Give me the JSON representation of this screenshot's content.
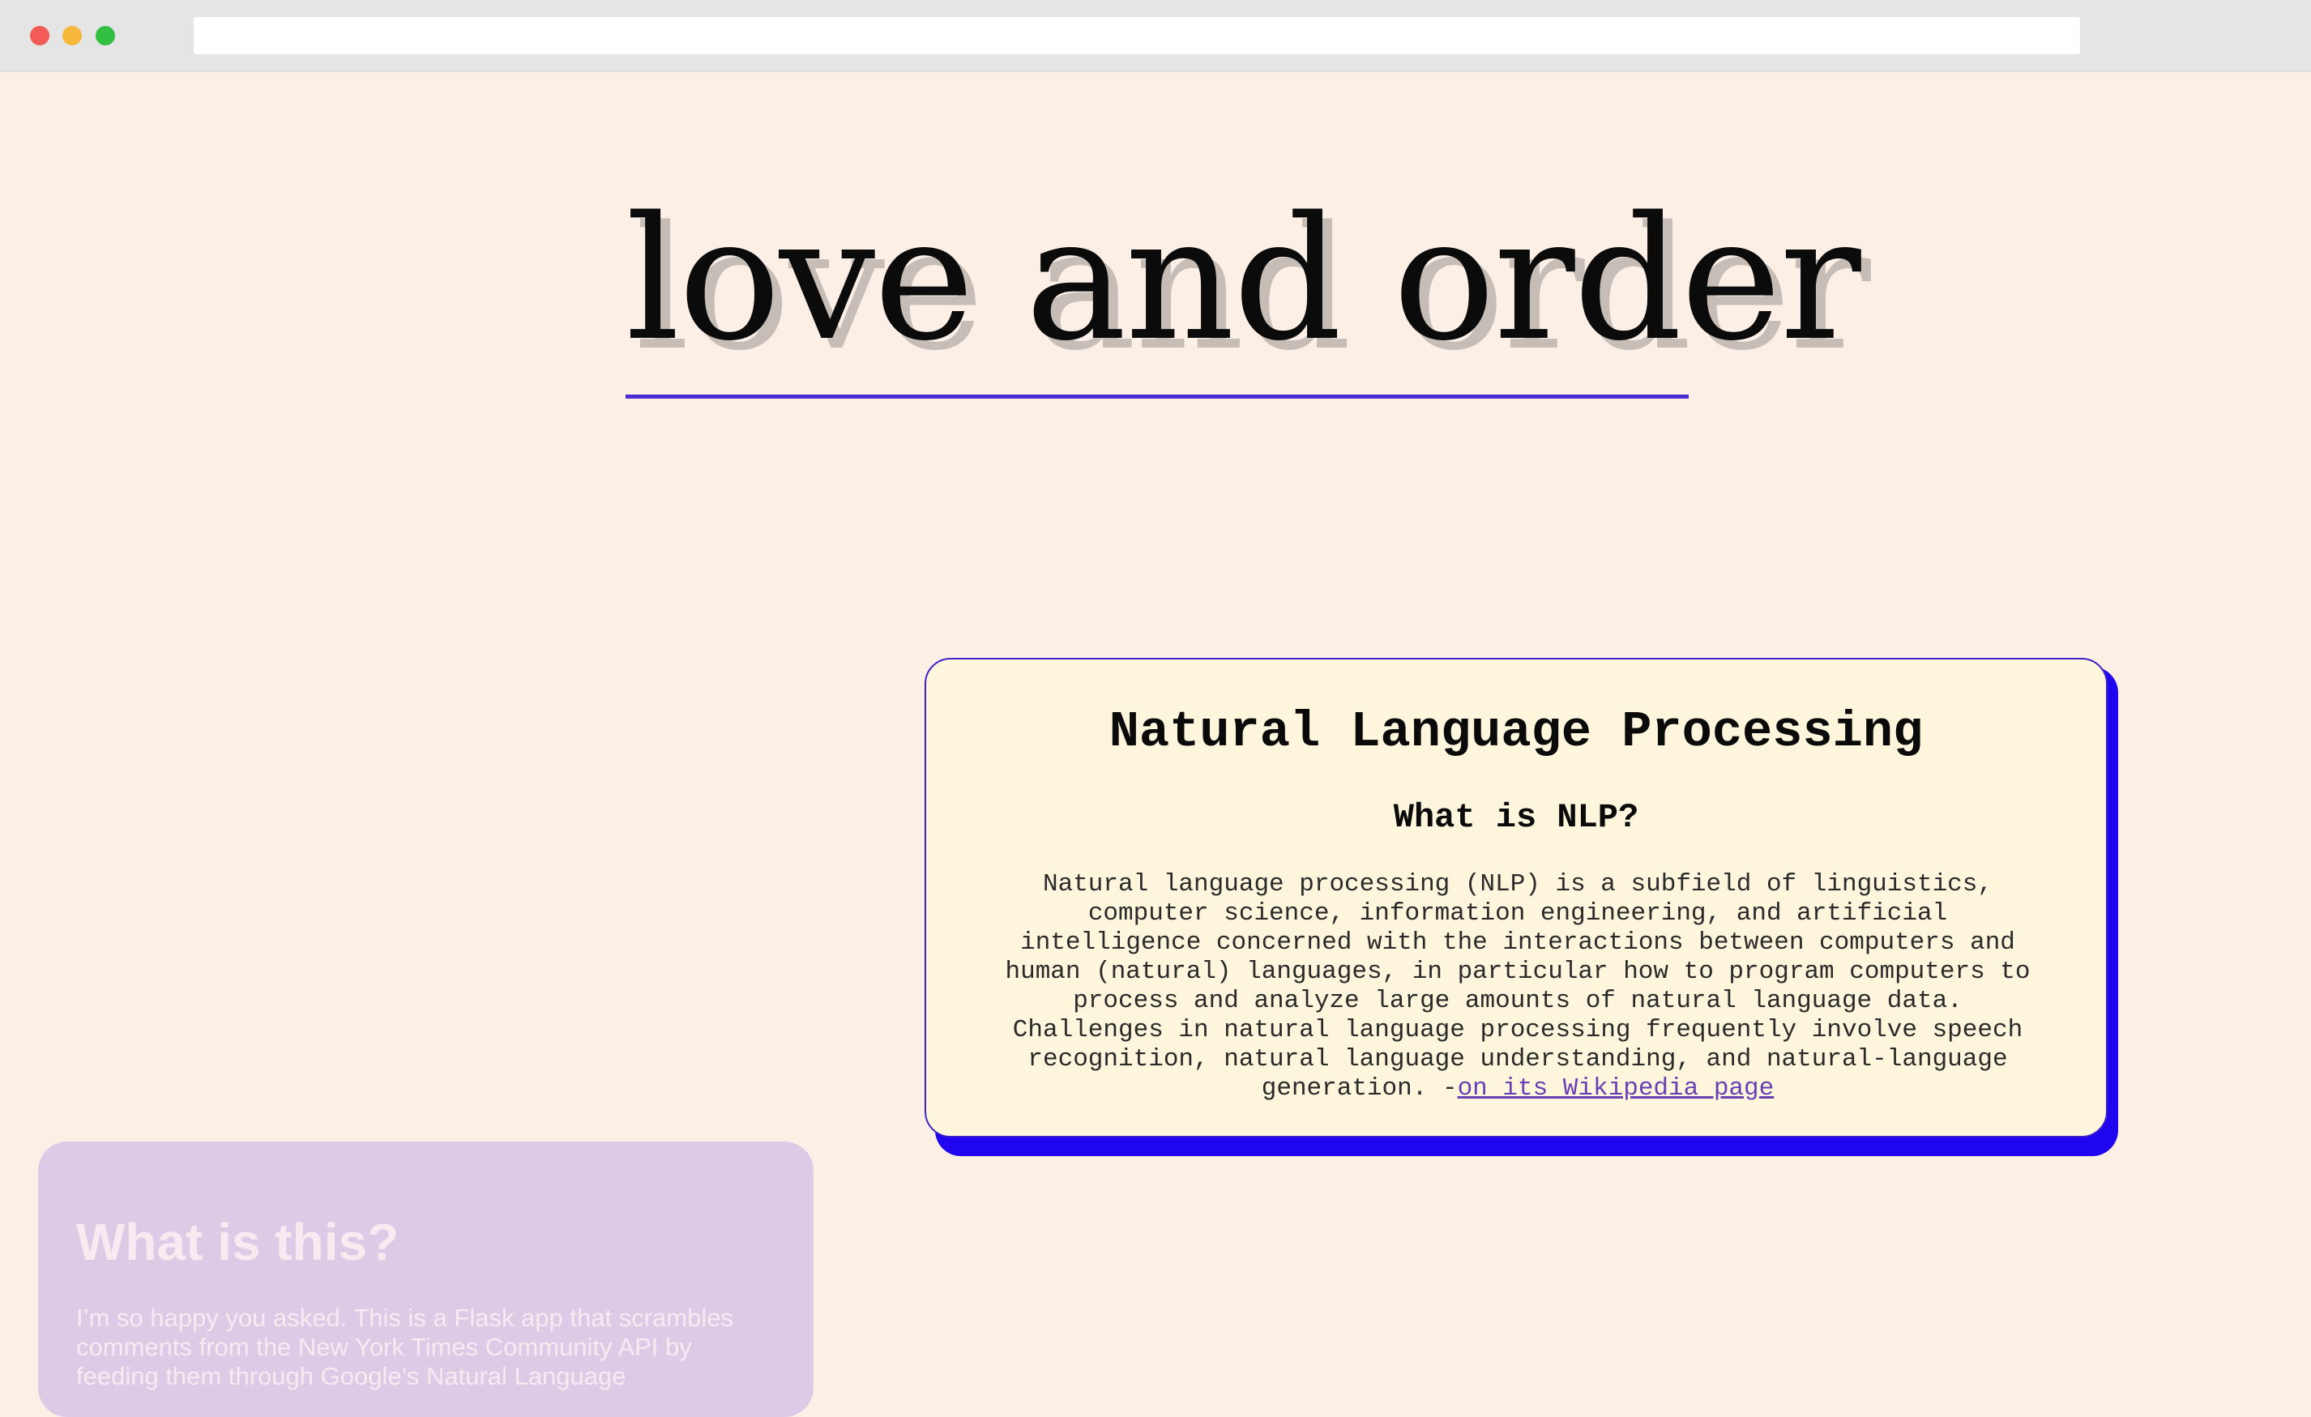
{
  "browser": {
    "window_controls": [
      "close",
      "minimize",
      "maximize"
    ],
    "address_bar_value": ""
  },
  "header": {
    "title": "love and order"
  },
  "card": {
    "heading": "Natural Language Processing",
    "subheading": "What is NLP?",
    "body": "Natural language processing (NLP) is a subfield of linguistics, computer science, information engineering, and artificial intelligence concerned with the interactions between computers and human (natural) languages, in particular how to program computers to process and analyze large amounts of natural language data. Challenges in natural language processing frequently involve speech recognition, natural language understanding, and natural-language generation. -",
    "link_text": "on its Wikipedia page"
  },
  "about": {
    "heading": "What is this?",
    "body": "I’m so happy you asked. This is a Flask app that scrambles comments from the New York Times Community API by feeding them through Google’s Natural Language"
  },
  "colors": {
    "background": "#fcefe6",
    "accent": "#4a2bd1",
    "card_shadow": "#1f05f0",
    "card_background": "#fdf6dd",
    "panel_background": "#dccbe6"
  }
}
